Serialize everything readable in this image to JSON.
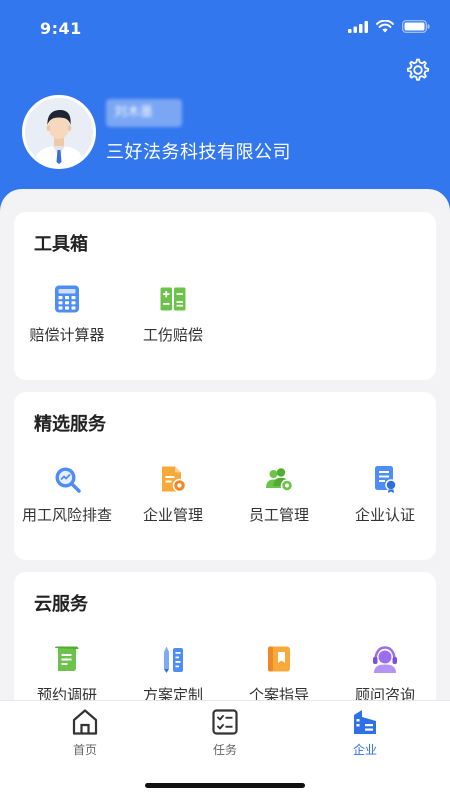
{
  "status_bar": {
    "time": "9:41"
  },
  "profile": {
    "name": "刘木墨",
    "company": "三好法务科技有限公司"
  },
  "sections": [
    {
      "title": "工具箱",
      "items": [
        {
          "label": "赔偿计算器",
          "icon": "calculator-icon"
        },
        {
          "label": "工伤赔偿",
          "icon": "injury-compensation-icon"
        }
      ]
    },
    {
      "title": "精选服务",
      "items": [
        {
          "label": "用工风险排查",
          "icon": "risk-search-icon"
        },
        {
          "label": "企业管理",
          "icon": "enterprise-management-icon"
        },
        {
          "label": "员工管理",
          "icon": "staff-management-icon"
        },
        {
          "label": "企业认证",
          "icon": "enterprise-certification-icon"
        }
      ]
    },
    {
      "title": "云服务",
      "items": [
        {
          "label": "预约调研",
          "icon": "appointment-research-icon"
        },
        {
          "label": "方案定制",
          "icon": "plan-customize-icon"
        },
        {
          "label": "个案指导",
          "icon": "case-guide-icon"
        },
        {
          "label": "顾问咨询",
          "icon": "consultant-icon"
        }
      ]
    }
  ],
  "tabbar": [
    {
      "label": "首页",
      "icon": "home-icon",
      "active": false
    },
    {
      "label": "任务",
      "icon": "task-icon",
      "active": false
    },
    {
      "label": "企业",
      "icon": "enterprise-icon",
      "active": true
    }
  ],
  "colors": {
    "primary": "#3377ee",
    "active_tab": "#2f6fe8",
    "background": "#f3f3f5"
  }
}
